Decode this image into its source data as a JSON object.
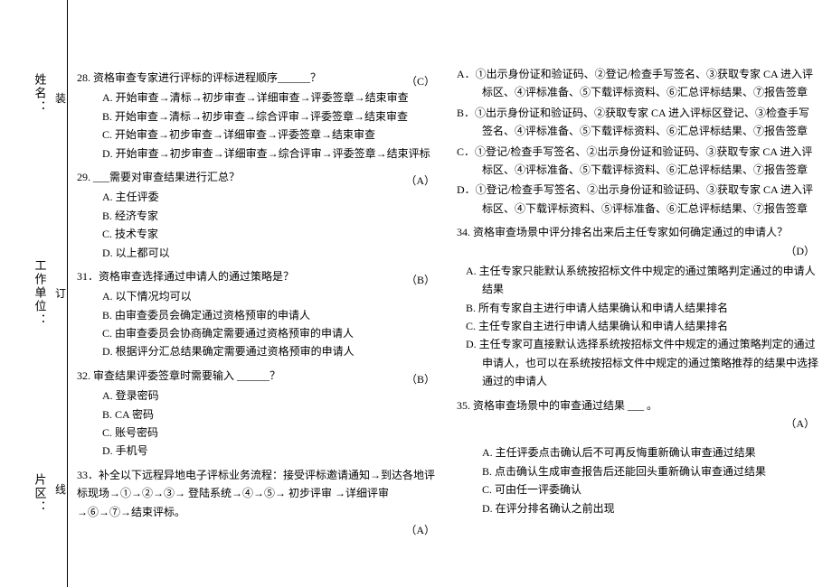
{
  "binding": {
    "label1": "姓名：",
    "label2": "工作单位：",
    "label3": "片区：",
    "mark1": "装",
    "mark2": "订",
    "mark3": "线"
  },
  "q28": {
    "stem": "28. 资格审查专家进行评标的评标进程顺序______？",
    "ans": "（C）",
    "a": "A. 开始审查→清标→初步审查→详细审查→评委签章→结束审查",
    "b": "B. 开始审查→清标→初步审查→综合评审→评委签章→结束审查",
    "c": "C. 开始审查→初步审查→详细审查→评委签章→结束审查",
    "d": "D. 开始审查→初步审查→详细审查→综合评审→评委签章→结束评标"
  },
  "q29": {
    "stem": "29. ___需要对审查结果进行汇总？",
    "ans": "（A）",
    "a": "A. 主任评委",
    "b": "B. 经济专家",
    "c": "C. 技术专家",
    "d": "D. 以上都可以"
  },
  "q31": {
    "stem": "31．资格审查选择通过申请人的通过策略是？",
    "ans": "（B）",
    "a": "A. 以下情况均可以",
    "b": "B. 由审查委员会确定通过资格预审的申请人",
    "c": "C. 由审查委员会协商确定需要通过资格预审的申请人",
    "d": "D. 根据评分汇总结果确定需要通过资格预审的申请人"
  },
  "q32": {
    "stem": "32. 审查结果评委签章时需要输入  ______？",
    "ans": "（B）",
    "a": "A. 登录密码",
    "b": "B. CA 密码",
    "c": "C. 账号密码",
    "d": "D. 手机号"
  },
  "q33": {
    "stem1": "33．补全以下远程异地电子评标业务流程：接受评标邀请通知→到达各地评标现场→①→②→③→ 登陆系统→④→⑤→ 初步评审 →详细评审→⑥→⑦→结束评标。",
    "ans": "（A）",
    "a": "A．①出示身份证和验证码、②登记/检查手写签名、③获取专家 CA 进入评标区、④评标准备、⑤下载评标资料、⑥汇总评标结果、⑦报告签章",
    "b": "B．①出示身份证和验证码、②获取专家 CA 进入评标区登记、③检查手写签名、④评标准备、⑤下载评标资料、⑥汇总评标结果、⑦报告签章",
    "c": "C．①登记/检查手写签名、②出示身份证和验证码、③获取专家 CA 进入评标区、④评标准备、⑤下载评标资料、⑥汇总评标结果、⑦报告签章",
    "d": "D．①登记/检查手写签名、②出示身份证和验证码、③获取专家 CA 进入评标区、④下载评标资料、⑤评标准备、⑥汇总评标结果、⑦报告签章"
  },
  "q34": {
    "stem": "34. 资格审查场景中评分排名出来后主任专家如何确定通过的申请人？",
    "ans": "（D）",
    "a": "A. 主任专家只能默认系统按招标文件中规定的通过策略判定通过的申请人结果",
    "b": "B. 所有专家自主进行申请人结果确认和申请人结果排名",
    "c": "C. 主任专家自主进行申请人结果确认和申请人结果排名",
    "d": "D. 主任专家可直接默认选择系统按招标文件中规定的通过策略判定的通过申请人，也可以在系统按招标文件中规定的通过策略推荐的结果中选择通过的申请人"
  },
  "q35": {
    "stem": "35. 资格审查场景中的审查通过结果  ___ 。",
    "ans": "（A）",
    "a": "A. 主任评委点击确认后不可再反悔重新确认审查通过结果",
    "b": "B. 点击确认生成审查报告后还能回头重新确认审查通过结果",
    "c": "C. 可由任一评委确认",
    "d": "D. 在评分排名确认之前出现"
  }
}
